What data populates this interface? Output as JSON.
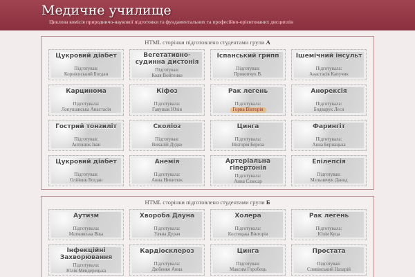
{
  "header": {
    "title": "Медичне училище",
    "subtitle": "Циклова комісія природничо-наукової підготовки та фундаментальних та професійно-орієнтованих дисциплін"
  },
  "groupA": {
    "title_prefix": "HTML сторінки підготовлено студентами групи",
    "title_letter": "А",
    "cards": [
      {
        "title": "Цукровий діабет",
        "prep": "Підготував:",
        "author": "Корнієнський Богдан"
      },
      {
        "title": "Вегетативно-судинна дистонія",
        "prep": "Підготував:",
        "author": "Коля Войтенко"
      },
      {
        "title": "Іспанський грипп",
        "prep": "Підготував:",
        "author": "Прокопчук В."
      },
      {
        "title": "Ішемічний інсульт",
        "prep": "Підготувала:",
        "author": "Анастасія Капучик"
      },
      {
        "title": "Карцинома",
        "prep": "Підготувала:",
        "author": "Лопушанська Анастасія"
      },
      {
        "title": "Кіфоз",
        "prep": "Підготувала:",
        "author": "Гавушак Юлія"
      },
      {
        "title": "Рак легень",
        "prep": "Підготувала:",
        "author": "Горна Вікторія"
      },
      {
        "title": "Анорексія",
        "prep": "Підготувала:",
        "author": "Бодварук Леся"
      },
      {
        "title": "Гострий тонзиліт",
        "prep": "Підготував:",
        "author": "Антонюк Іван"
      },
      {
        "title": "Сколіоз",
        "prep": "Підготував:",
        "author": "Вихалій Дудко"
      },
      {
        "title": "Цинга",
        "prep": "Підготувала:",
        "author": "Вікторія Береза"
      },
      {
        "title": "Фарингіт",
        "prep": "Підготувала:",
        "author": "Анна Бернацька"
      },
      {
        "title": "Цукровий діабет",
        "prep": "Підготував:",
        "author": "Олійник Богдан"
      },
      {
        "title": "Анемія",
        "prep": "Підготувала:",
        "author": "Анна Никитюк"
      },
      {
        "title": "Артеріальна гіпертонія",
        "prep": "Підготувала:",
        "author": "Анна Слюсар"
      },
      {
        "title": "Епілепсія",
        "prep": "Підготував:",
        "author": "Мельничук Давид"
      }
    ]
  },
  "groupB": {
    "title_prefix": "HTML сторінки підготовлено студентами групи",
    "title_letter": "Б",
    "cards": [
      {
        "title": "Аутизм",
        "prep": "Підготувала:",
        "author": "Матковська Віка"
      },
      {
        "title": "Хвороба Дауна",
        "prep": "Підготувала:",
        "author": "Уляна Дурач"
      },
      {
        "title": "Холера",
        "prep": "Підготувала:",
        "author": "Костецька Вікторія"
      },
      {
        "title": "Рак легень",
        "prep": "Підготувала:",
        "author": "Юлія Куца"
      },
      {
        "title": "Інфекційні Захворювання",
        "prep": "Підготувала:",
        "author": "Юлія Мендерецька"
      },
      {
        "title": "Кардіосклероз",
        "prep": "Підготувала:",
        "author": "Дюбенко Анна"
      },
      {
        "title": "Цинга",
        "prep": "Підготував:",
        "author": "Максим Горобець"
      },
      {
        "title": "Простата",
        "prep": "Підготував:",
        "author": "Сливінський Назарій"
      }
    ]
  }
}
